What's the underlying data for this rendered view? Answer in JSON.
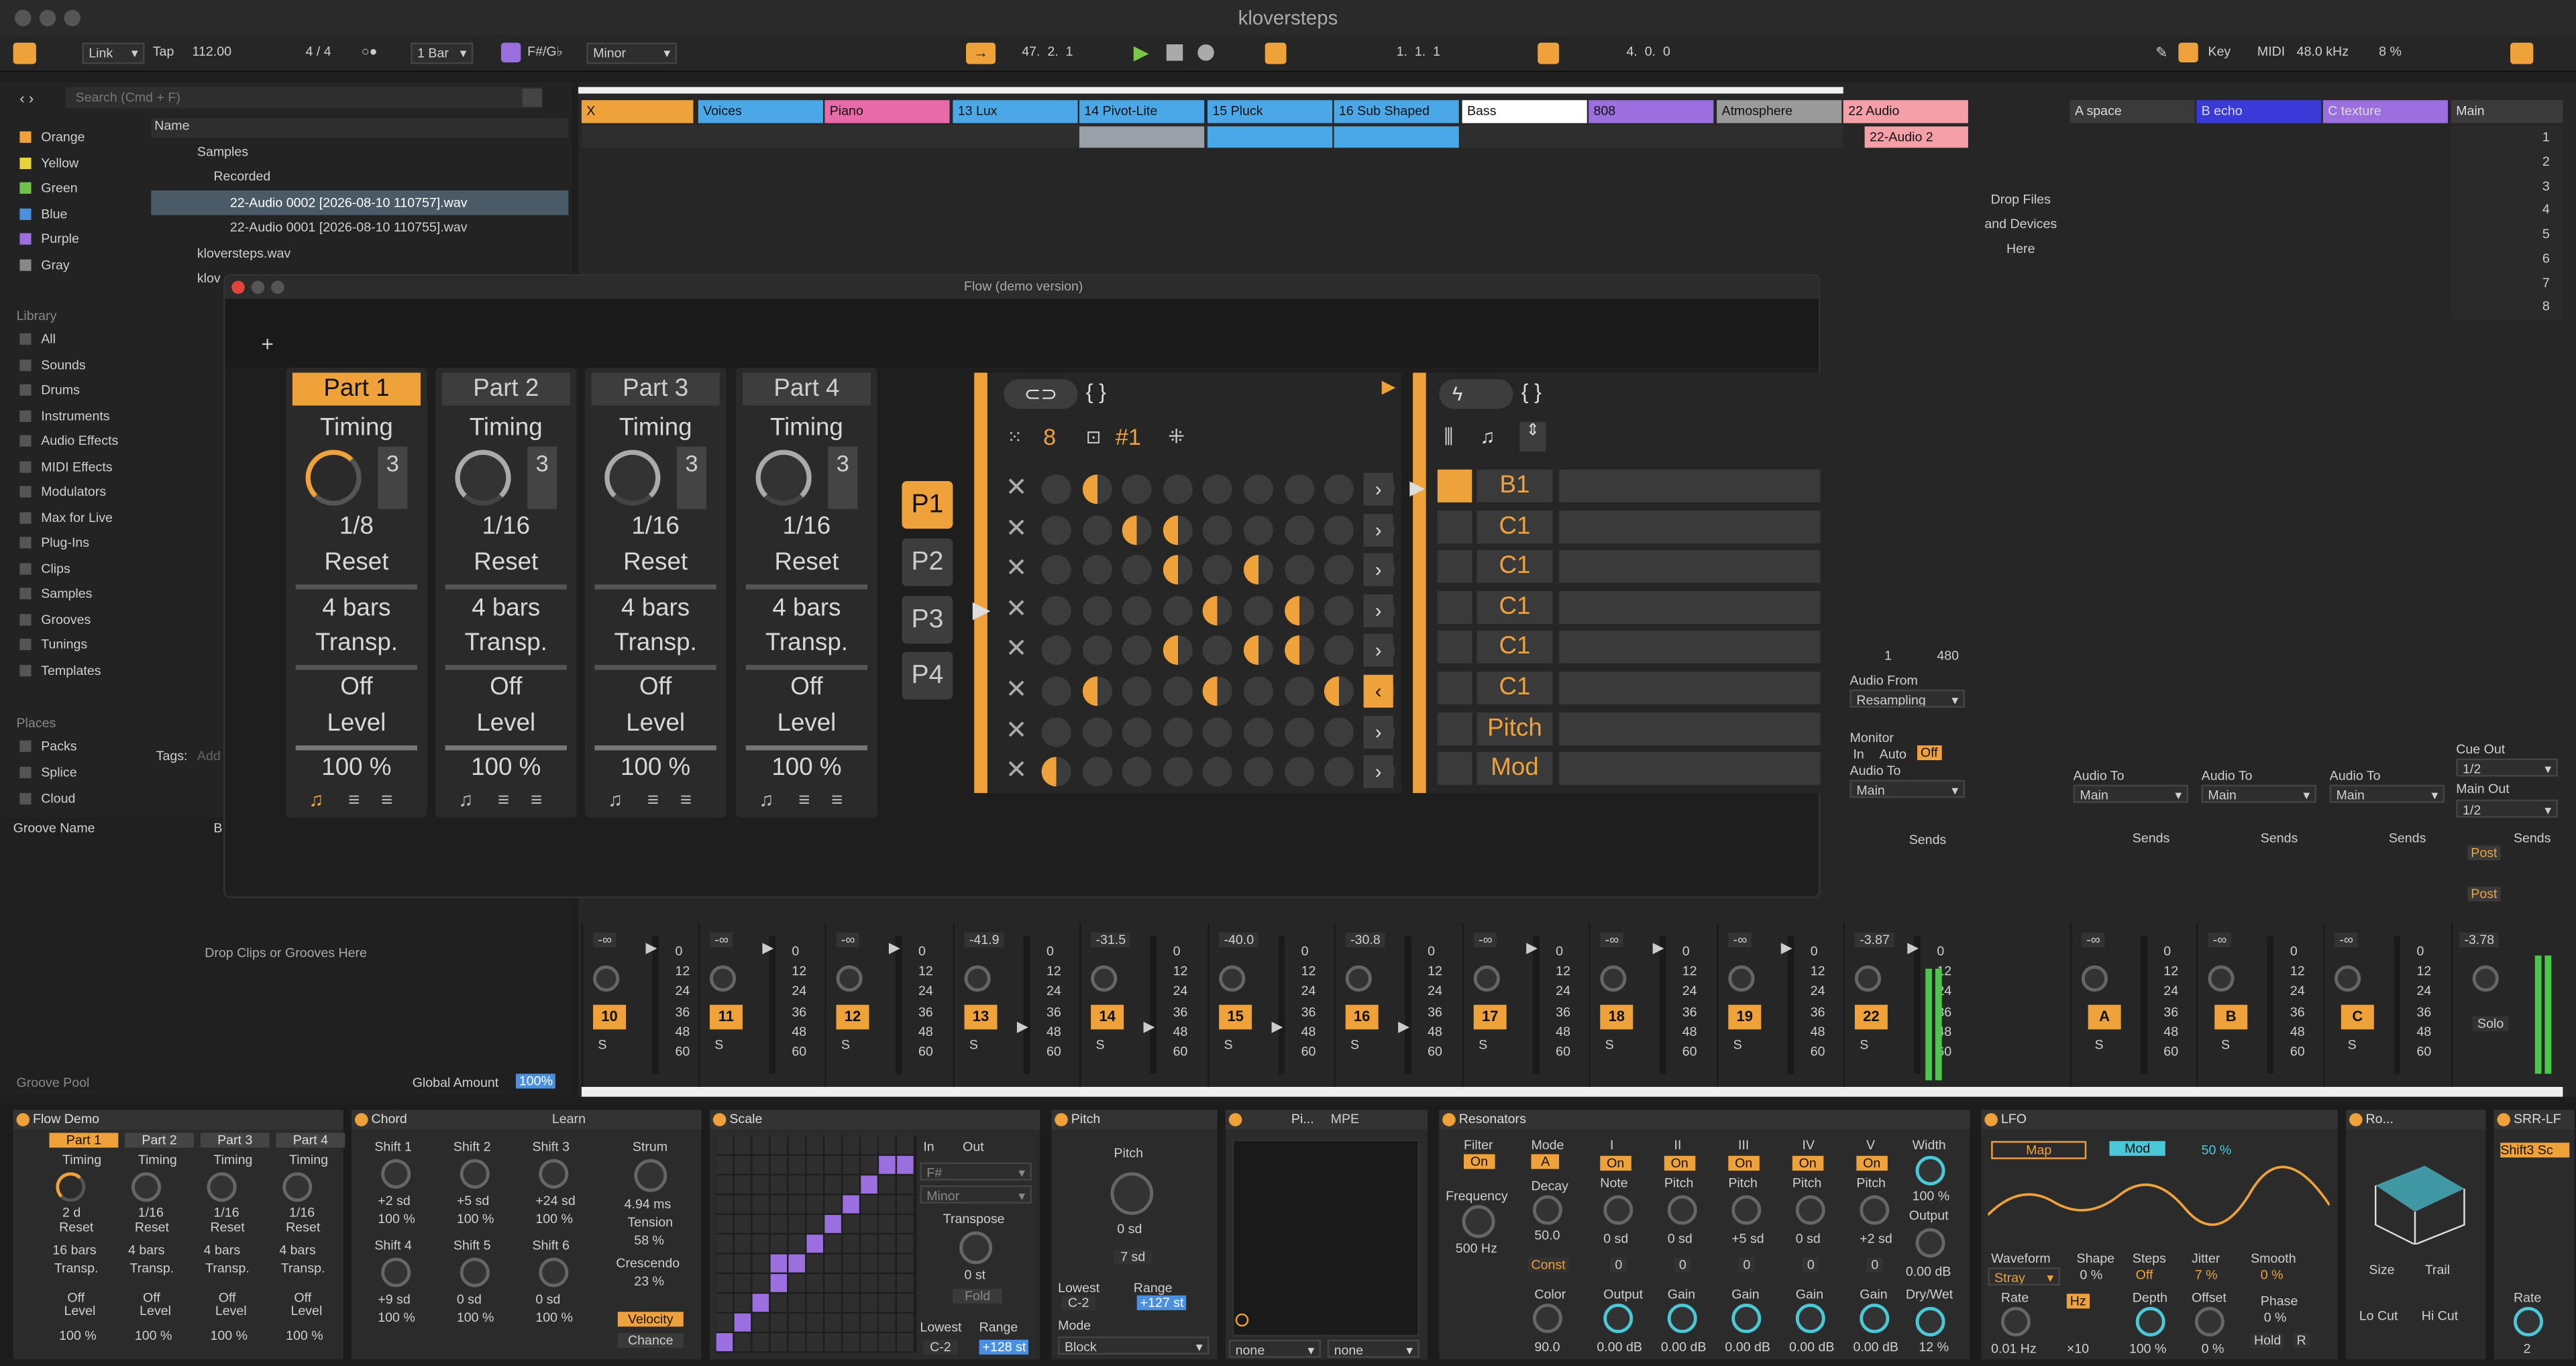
{
  "window": {
    "title": "kloversteps"
  },
  "transport": {
    "link": "Link",
    "tap": "Tap",
    "tempo": "112.00",
    "meter": "4 / 4",
    "quant": "1 Bar",
    "key": "F#/G♭",
    "scale": "Minor",
    "position": "47.  2.  1",
    "loop_start": "1.  1.  1",
    "loop_len": "4.  0.  0",
    "key_btn": "Key",
    "midi_btn": "MIDI",
    "sample_rate": "48.0 kHz",
    "cpu": "8 %"
  },
  "browser": {
    "search_placeholder": "Search (Cmd + F)",
    "colors": [
      {
        "name": "Orange",
        "color": "#f0a23a"
      },
      {
        "name": "Yellow",
        "color": "#e6d23a"
      },
      {
        "name": "Green",
        "color": "#6fc24a"
      },
      {
        "name": "Blue",
        "color": "#4a90e2"
      },
      {
        "name": "Purple",
        "color": "#9b6fe0"
      },
      {
        "name": "Gray",
        "color": "#888888"
      }
    ],
    "library_label": "Library",
    "library": [
      "All",
      "Sounds",
      "Drums",
      "Instruments",
      "Audio Effects",
      "MIDI Effects",
      "Modulators",
      "Max for Live",
      "Plug-Ins",
      "Clips",
      "Samples",
      "Grooves",
      "Tunings",
      "Templates"
    ],
    "places_label": "Places",
    "places": [
      "Packs",
      "Splice",
      "Cloud"
    ],
    "name_col": "Name",
    "tree": [
      "Samples",
      "Recorded",
      "22-Audio 0002 [2026-08-10 110757].wav",
      "22-Audio 0001 [2026-08-10 110755].wav",
      "kloversteps.wav",
      "klov"
    ],
    "tags_label": "Tags:",
    "tags_add": "Add",
    "groove_name": "Groove Name",
    "groove_b": "B",
    "drop_grooves": "Drop Clips or Grooves Here",
    "groove_pool": "Groove Pool",
    "global_amount": "Global Amount",
    "global_amount_val": "100%"
  },
  "tracks": [
    {
      "name": "X",
      "color": "#f0a23a"
    },
    {
      "name": "Voices",
      "color": "#4aa8e8"
    },
    {
      "name": "Piano",
      "color": "#e86aa8"
    },
    {
      "name": "13 Lux",
      "color": "#4aa8e8"
    },
    {
      "name": "14 Pivot-Lite",
      "color": "#4aa8e8"
    },
    {
      "name": "15 Pluck",
      "color": "#4aa8e8"
    },
    {
      "name": "16 Sub Shaped",
      "color": "#4aa8e8"
    },
    {
      "name": "Bass",
      "color": "#ffffff"
    },
    {
      "name": "808",
      "color": "#9b6fe0"
    },
    {
      "name": "Atmosphere",
      "color": "#9a9a9a"
    },
    {
      "name": "22 Audio",
      "color": "#f5a0a8"
    }
  ],
  "returns": [
    {
      "name": "A space",
      "color": "#3a3a3a"
    },
    {
      "name": "B echo",
      "color": "#3a3ad8"
    },
    {
      "name": "C texture",
      "color": "#9b6fe0"
    },
    {
      "name": "Main",
      "color": "#3a3a3a"
    }
  ],
  "clip_22": "22-Audio 2",
  "drop_files": "Drop Files and Devices Here",
  "scene_numbers": [
    "1",
    "2",
    "3",
    "4",
    "5",
    "6",
    "7",
    "8"
  ],
  "mixer": {
    "strips": [
      {
        "num": "10",
        "vol": "-∞"
      },
      {
        "num": "11",
        "vol": "-∞"
      },
      {
        "num": "12",
        "vol": "-∞"
      },
      {
        "num": "13",
        "vol": "-41.9"
      },
      {
        "num": "14",
        "vol": "-31.5"
      },
      {
        "num": "15",
        "vol": "-40.0"
      },
      {
        "num": "16",
        "vol": "-30.8"
      },
      {
        "num": "17",
        "vol": "-∞"
      },
      {
        "num": "18",
        "vol": "-∞"
      },
      {
        "num": "19",
        "vol": "-∞"
      },
      {
        "num": "22",
        "vol": "-3.87"
      }
    ],
    "return_strips": [
      {
        "num": "A",
        "vol": "-∞"
      },
      {
        "num": "B",
        "vol": "-∞"
      },
      {
        "num": "C",
        "vol": "-∞"
      }
    ],
    "master_vol": "-3.78",
    "scale": [
      "0",
      "12",
      "24",
      "36",
      "48",
      "60"
    ],
    "solo": "S",
    "solo_text": "Solo",
    "audio_from": "Audio From",
    "resampling": "Resampling",
    "monitor": "Monitor",
    "mon_in": "In",
    "mon_auto": "Auto",
    "mon_off": "Off",
    "audio_to": "Audio To",
    "main": "Main",
    "sends": "Sends",
    "cue_out": "Cue Out",
    "main_out": "Main Out",
    "half": "1/2",
    "post": "Post",
    "count1": "1",
    "count2": "480"
  },
  "flow": {
    "title": "Flow (demo version)",
    "parts": [
      {
        "name": "Part 1",
        "timing": "Timing",
        "rate": "1/8",
        "reset": "Reset",
        "bars": "4 bars",
        "transp": "Transp.",
        "off": "Off",
        "level": "Level",
        "pct": "100 %",
        "n": "3"
      },
      {
        "name": "Part 2",
        "timing": "Timing",
        "rate": "1/16",
        "reset": "Reset",
        "bars": "4 bars",
        "transp": "Transp.",
        "off": "Off",
        "level": "Level",
        "pct": "100 %",
        "n": "3"
      },
      {
        "name": "Part 3",
        "timing": "Timing",
        "rate": "1/16",
        "reset": "Reset",
        "bars": "4 bars",
        "transp": "Transp.",
        "off": "Off",
        "level": "Level",
        "pct": "100 %",
        "n": "3"
      },
      {
        "name": "Part 4",
        "timing": "Timing",
        "rate": "1/16",
        "reset": "Reset",
        "bars": "4 bars",
        "transp": "Transp.",
        "off": "Off",
        "level": "Level",
        "pct": "100 %",
        "n": "3"
      }
    ],
    "pbtns": [
      "P1",
      "P2",
      "P3",
      "P4"
    ],
    "grid_steps": "8",
    "grid_pattern": "#1",
    "notes": [
      "B1",
      "C1",
      "C1",
      "C1",
      "C1",
      "C1"
    ],
    "pitch": "Pitch",
    "mod": "Mod"
  },
  "devices": {
    "flowdemo": {
      "title": "Flow Demo",
      "parts": [
        "Part 1",
        "Part 2",
        "Part 3",
        "Part 4"
      ],
      "timing": "Timing",
      "rates": [
        "2 d",
        "1/16",
        "1/16",
        "1/16"
      ],
      "reset": "Reset",
      "bars": [
        "16 bars",
        "4 bars",
        "4 bars",
        "4 bars"
      ],
      "transp": "Transp.",
      "off": "Off",
      "level": "Level",
      "pct": "100 %"
    },
    "chord": {
      "title": "Chord",
      "learn": "Learn",
      "shifts": [
        "Shift 1",
        "Shift 2",
        "Shift 3",
        "Shift 4",
        "Shift 5",
        "Shift 6"
      ],
      "vals": [
        "+2 sd",
        "+5 sd",
        "+24 sd",
        "+9 sd",
        "0 sd",
        "0 sd"
      ],
      "pct": "100 %",
      "strum": "Strum",
      "strum_v": "4.94 ms",
      "tension": "Tension",
      "tension_v": "58 %",
      "crescendo": "Crescendo",
      "cresc_v": "23 %",
      "velocity": "Velocity",
      "chance": "Chance"
    },
    "scale": {
      "title": "Scale",
      "in": "In",
      "out": "Out",
      "base": "F#",
      "mode": "Minor",
      "transpose": "Transpose",
      "transp_v": "0 st",
      "fold": "Fold",
      "lowest": "Lowest",
      "lowest_v": "C-2",
      "range": "Range",
      "range_v": "+128 st"
    },
    "pitch": {
      "title": "Pitch",
      "pitch": "Pitch",
      "pitch_v": "0 sd",
      "steps": "7 sd",
      "lowest": "Lowest",
      "lowest_v": "C-2",
      "range": "Range",
      "range_v": "+127 st",
      "mode": "Mode",
      "mode_v": "Block"
    },
    "pi": {
      "title": "Pi...",
      "mpe": "MPE",
      "none1": "none",
      "none2": "none"
    },
    "resonators": {
      "title": "Resonators",
      "filter": "Filter",
      "on": "On",
      "freq": "Frequency",
      "freq_v": "500 Hz",
      "mode": "Mode",
      "mode_v": "A",
      "decay": "Decay",
      "decay_v": "50.0",
      "const": "Const",
      "color": "Color",
      "color_v": "90.0",
      "cols": [
        "I",
        "II",
        "III",
        "IV",
        "V"
      ],
      "note": "Note",
      "pitch": "Pitch",
      "vals": [
        "0 sd",
        "0 sd",
        "+5 sd",
        "0 sd",
        "+2 sd"
      ],
      "sub": [
        "0",
        "0",
        "0",
        "0",
        "0"
      ],
      "output": "Output",
      "gain": "Gain",
      "gain_v": "0.00 dB",
      "width": "Width",
      "width_v": "100 %",
      "drywet": "Dry/Wet",
      "drywet_v": "12 %",
      "out_v": "0.00 dB"
    },
    "lfo": {
      "title": "LFO",
      "map": "Map",
      "mod": "Mod",
      "pct": "50 %",
      "waveform": "Waveform",
      "wave_v": "Stray",
      "shape": "Shape",
      "shape_v": "0 %",
      "steps": "Steps",
      "steps_v": "Off",
      "jitter": "Jitter",
      "jitter_v": "7 %",
      "smooth": "Smooth",
      "smooth_v": "0 %",
      "rate": "Rate",
      "rate_v": "0.01 Hz",
      "hz": "Hz",
      "x10": "×10",
      "depth": "Depth",
      "depth_v": "100 %",
      "offset": "Offset",
      "offset_v": "0 %",
      "phase": "Phase",
      "phase_v": "0 %",
      "hold": "Hold",
      "r": "R"
    },
    "ro": {
      "title": "Ro...",
      "size": "Size",
      "trail": "Trail",
      "locut": "Lo Cut",
      "hicut": "Hi Cut"
    },
    "srr": {
      "title": "SRR-LF",
      "mode": "Shift3 Sc",
      "rate": "Rate",
      "rate_v": "2"
    }
  }
}
